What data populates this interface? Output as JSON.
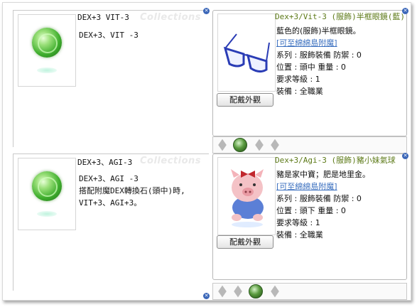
{
  "watermark": "Collections",
  "items": [
    {
      "title": "DEX+3 VIT-3",
      "desc_lines": [
        "DEX+3、VIT -3"
      ]
    },
    {
      "title": "DEX+3、AGI-3",
      "desc_lines": [
        "DEX+3、AGI -3",
        "搭配附魔DEX轉換石(頭中)時,",
        "VIT+3、AGI+3。"
      ]
    }
  ],
  "panels": [
    {
      "title": "Dex+3/Vit-3 (服飾)半框眼鏡(藍)",
      "desc": "藍色的(服飾)半框眼鏡。",
      "link": "[可至綿綿島附魔]",
      "series_line": "系列 : 服飾裝備 防禦 : 0",
      "position_line": "位置 : 頭中   重量 : 0",
      "level_line": "要求等級 : 1",
      "equip_line": "裝備 : 全職業",
      "button": "配戴外觀"
    },
    {
      "title": "Dex+3/Agi-3 (服飾)豬小妹氣球",
      "desc": "豬是家中寶；肥是地里金。",
      "link": "[可至綿綿島附魔]",
      "series_line": "系列 : 服飾裝備  防禦 : 0",
      "position_line": "位置 : 頭下   重量 : 0",
      "level_line": "要求等級 : 1",
      "equip_line": "裝備 : 全職業",
      "button": "配戴外觀"
    }
  ],
  "colors": {
    "panel_title": "#5d7a18",
    "link": "#3a6fbf",
    "close_button": "#3a66b8"
  },
  "icons": [
    "green-orb-icon",
    "blue-glasses-icon",
    "pig-balloon-icon",
    "close-icon",
    "slot-diamond-icon"
  ]
}
